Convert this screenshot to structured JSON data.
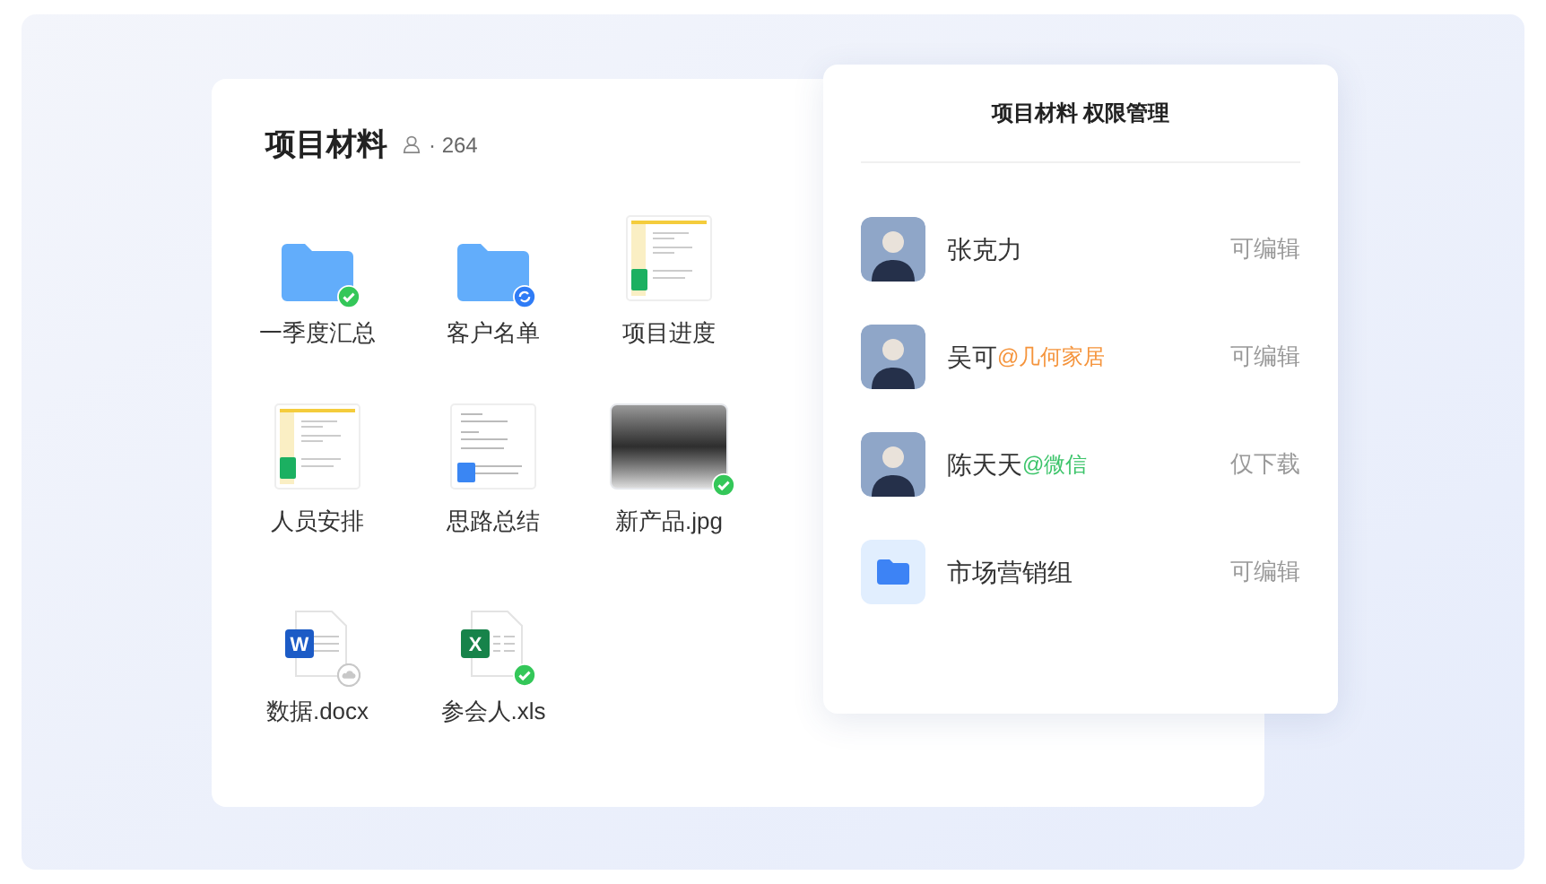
{
  "folder_card": {
    "title": "项目材料",
    "member_count": "· 264",
    "files": [
      {
        "name": "一季度汇总",
        "kind": "folder",
        "synced": true,
        "syncing": false,
        "cloud_only": false
      },
      {
        "name": "客户名单",
        "kind": "folder",
        "synced": false,
        "syncing": true,
        "cloud_only": false
      },
      {
        "name": "项目进度",
        "kind": "sheet",
        "synced": false,
        "syncing": false,
        "cloud_only": false
      },
      {
        "name": "人员安排",
        "kind": "sheet",
        "synced": false,
        "syncing": false,
        "cloud_only": false
      },
      {
        "name": "思路总结",
        "kind": "doc",
        "synced": false,
        "syncing": false,
        "cloud_only": false
      },
      {
        "name": "新产品.jpg",
        "kind": "image",
        "synced": true,
        "syncing": false,
        "cloud_only": false
      },
      {
        "name": "数据.docx",
        "kind": "word",
        "letter": "W",
        "synced": false,
        "syncing": false,
        "cloud_only": true
      },
      {
        "name": "参会人.xls",
        "kind": "excel",
        "letter": "X",
        "synced": true,
        "syncing": false,
        "cloud_only": false
      }
    ]
  },
  "permissions_panel": {
    "title": "项目材料 权限管理",
    "members": [
      {
        "name": "张克力",
        "kind": "person",
        "permission": "可编辑"
      },
      {
        "name": "吴可",
        "kind": "person",
        "tag": "@几何家居",
        "color": "#f5943c",
        "permission": "可编辑"
      },
      {
        "name": "陈天天",
        "kind": "person",
        "tag": "@微信",
        "color": "#3cc46a",
        "permission": "仅下载"
      },
      {
        "name": "市场营销组",
        "kind": "group",
        "permission": "可编辑"
      }
    ]
  }
}
